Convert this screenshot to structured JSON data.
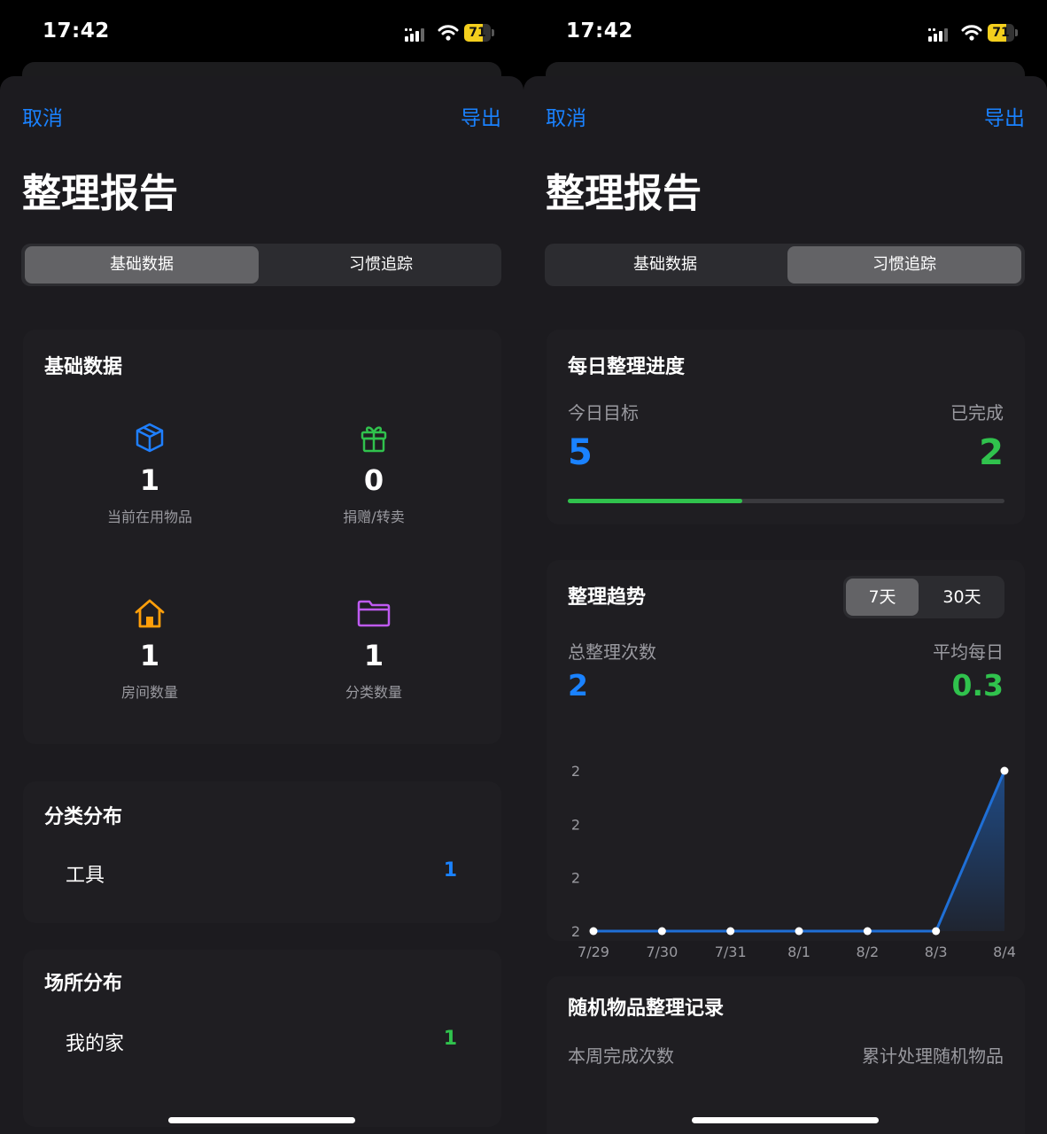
{
  "status": {
    "time": "17:42",
    "battery": "71",
    "battery_level": 0.71
  },
  "nav": {
    "cancel": "取消",
    "export": "导出"
  },
  "page_title": "整理报告",
  "tabs": [
    "基础数据",
    "习惯追踪"
  ],
  "left": {
    "basic_title": "基础数据",
    "stats": [
      {
        "icon": "cube-icon",
        "value": "1",
        "label": "当前在用物品",
        "color": "#1f7fff"
      },
      {
        "icon": "gift-icon",
        "value": "0",
        "label": "捐赠/转卖",
        "color": "#30c24d"
      },
      {
        "icon": "house-icon",
        "value": "1",
        "label": "房间数量",
        "color": "#ff9f0a"
      },
      {
        "icon": "folder-icon",
        "value": "1",
        "label": "分类数量",
        "color": "#bf5af2"
      }
    ],
    "category_title": "分类分布",
    "category_rows": [
      {
        "label": "工具",
        "value": "1",
        "color": "#1a82ff"
      }
    ],
    "place_title": "场所分布",
    "place_rows": [
      {
        "label": "我的家",
        "value": "1",
        "color": "#30c24d"
      }
    ]
  },
  "right": {
    "daily_title": "每日整理进度",
    "goal_label": "今日目标",
    "goal_value": "5",
    "done_label": "已完成",
    "done_value": "2",
    "progress": 0.4,
    "trend_title": "整理趋势",
    "range_options": [
      "7天",
      "30天"
    ],
    "total_label": "总整理次数",
    "total_value": "2",
    "avg_label": "平均每日",
    "avg_value": "0.3",
    "random_title": "随机物品整理记录",
    "week_label": "本周完成次数",
    "cumulative_label": "累计处理随机物品"
  },
  "colors": {
    "accent": "#1a82ff",
    "green": "#30c24d",
    "line": "#1f6fd6"
  },
  "chart_data": {
    "type": "area",
    "x": [
      "7/29",
      "7/30",
      "7/31",
      "8/1",
      "8/2",
      "8/3",
      "8/4"
    ],
    "series": [
      {
        "values": [
          0,
          0,
          0,
          0,
          0,
          0,
          2
        ]
      }
    ],
    "y_tick_labels": [
      "2",
      "2",
      "2",
      "2"
    ],
    "ylim": [
      0,
      2
    ],
    "grid": false,
    "legend": "none"
  }
}
